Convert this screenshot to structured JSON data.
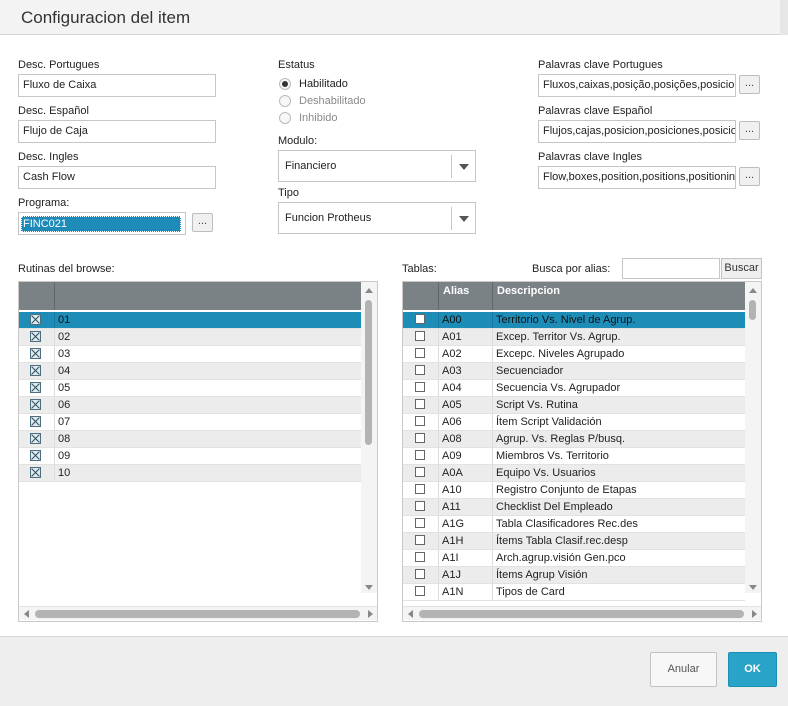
{
  "window": {
    "title": "Configuracion del item"
  },
  "form": {
    "desc_pt_label": "Desc. Portugues",
    "desc_pt_value": "Fluxo de Caixa",
    "desc_es_label": "Desc. Español",
    "desc_es_value": "Flujo de Caja",
    "desc_en_label": "Desc. Ingles",
    "desc_en_value": "Cash Flow",
    "programa_label": "Programa:",
    "programa_value": "FINC021",
    "estatus_label": "Estatus",
    "estatus_options": [
      "Habilitado",
      "Deshabilitado",
      "Inhibido"
    ],
    "estatus_selected": "Habilitado",
    "modulo_label": "Modulo:",
    "modulo_value": "Financiero",
    "tipo_label": "Tipo",
    "tipo_value": "Funcion Protheus",
    "kw_pt_label": "Palavras clave Portugues",
    "kw_pt_value": "Fluxos,caixas,posição,posições,posicio",
    "kw_es_label": "Palavras clave Español",
    "kw_es_value": "Flujos,cajas,posicion,posiciones,posicio",
    "kw_en_label": "Palavras clave Ingles",
    "kw_en_value": "Flow,boxes,position,positions,positionin",
    "ellipsis": "..."
  },
  "routines": {
    "label": "Rutinas del browse:",
    "rows": [
      {
        "value": "01",
        "checked": true
      },
      {
        "value": "02",
        "checked": true
      },
      {
        "value": "03",
        "checked": true
      },
      {
        "value": "04",
        "checked": true
      },
      {
        "value": "05",
        "checked": true
      },
      {
        "value": "06",
        "checked": true
      },
      {
        "value": "07",
        "checked": true
      },
      {
        "value": "08",
        "checked": true
      },
      {
        "value": "09",
        "checked": true
      },
      {
        "value": "10",
        "checked": true
      }
    ],
    "selected_index": 0
  },
  "tables": {
    "label": "Tablas:",
    "search_label": "Busca por alias:",
    "search_value": "",
    "search_button": "Buscar",
    "columns": [
      "",
      "Alias",
      "Descripcion"
    ],
    "rows": [
      {
        "alias": "A00",
        "desc": "Territorio Vs. Nivel de Agrup."
      },
      {
        "alias": "A01",
        "desc": "Excep. Territor Vs. Agrup."
      },
      {
        "alias": "A02",
        "desc": "Excepc. Niveles Agrupado"
      },
      {
        "alias": "A03",
        "desc": "Secuenciador"
      },
      {
        "alias": "A04",
        "desc": "Secuencia Vs. Agrupador"
      },
      {
        "alias": "A05",
        "desc": "Script Vs. Rutina"
      },
      {
        "alias": "A06",
        "desc": "Ítem Script Validación"
      },
      {
        "alias": "A08",
        "desc": "Agrup. Vs. Reglas P/busq."
      },
      {
        "alias": "A09",
        "desc": "Miembros Vs. Territorio"
      },
      {
        "alias": "A0A",
        "desc": "Equipo Vs. Usuarios"
      },
      {
        "alias": "A10",
        "desc": "Registro Conjunto de Etapas"
      },
      {
        "alias": "A11",
        "desc": "Checklist Del Empleado"
      },
      {
        "alias": "A1G",
        "desc": "Tabla Clasificadores Rec.des"
      },
      {
        "alias": "A1H",
        "desc": "Ítems Tabla Clasif.rec.desp"
      },
      {
        "alias": "A1I",
        "desc": "Arch.agrup.visión Gen.pco"
      },
      {
        "alias": "A1J",
        "desc": "Ítems Agrup Visión"
      },
      {
        "alias": "A1N",
        "desc": "Tipos de Card"
      }
    ],
    "selected_index": 0
  },
  "footer": {
    "cancel_label": "Anular",
    "ok_label": "OK"
  },
  "colors": {
    "accent": "#2aa3c8",
    "header": "#7a8286",
    "selection": "#1d8db8"
  }
}
